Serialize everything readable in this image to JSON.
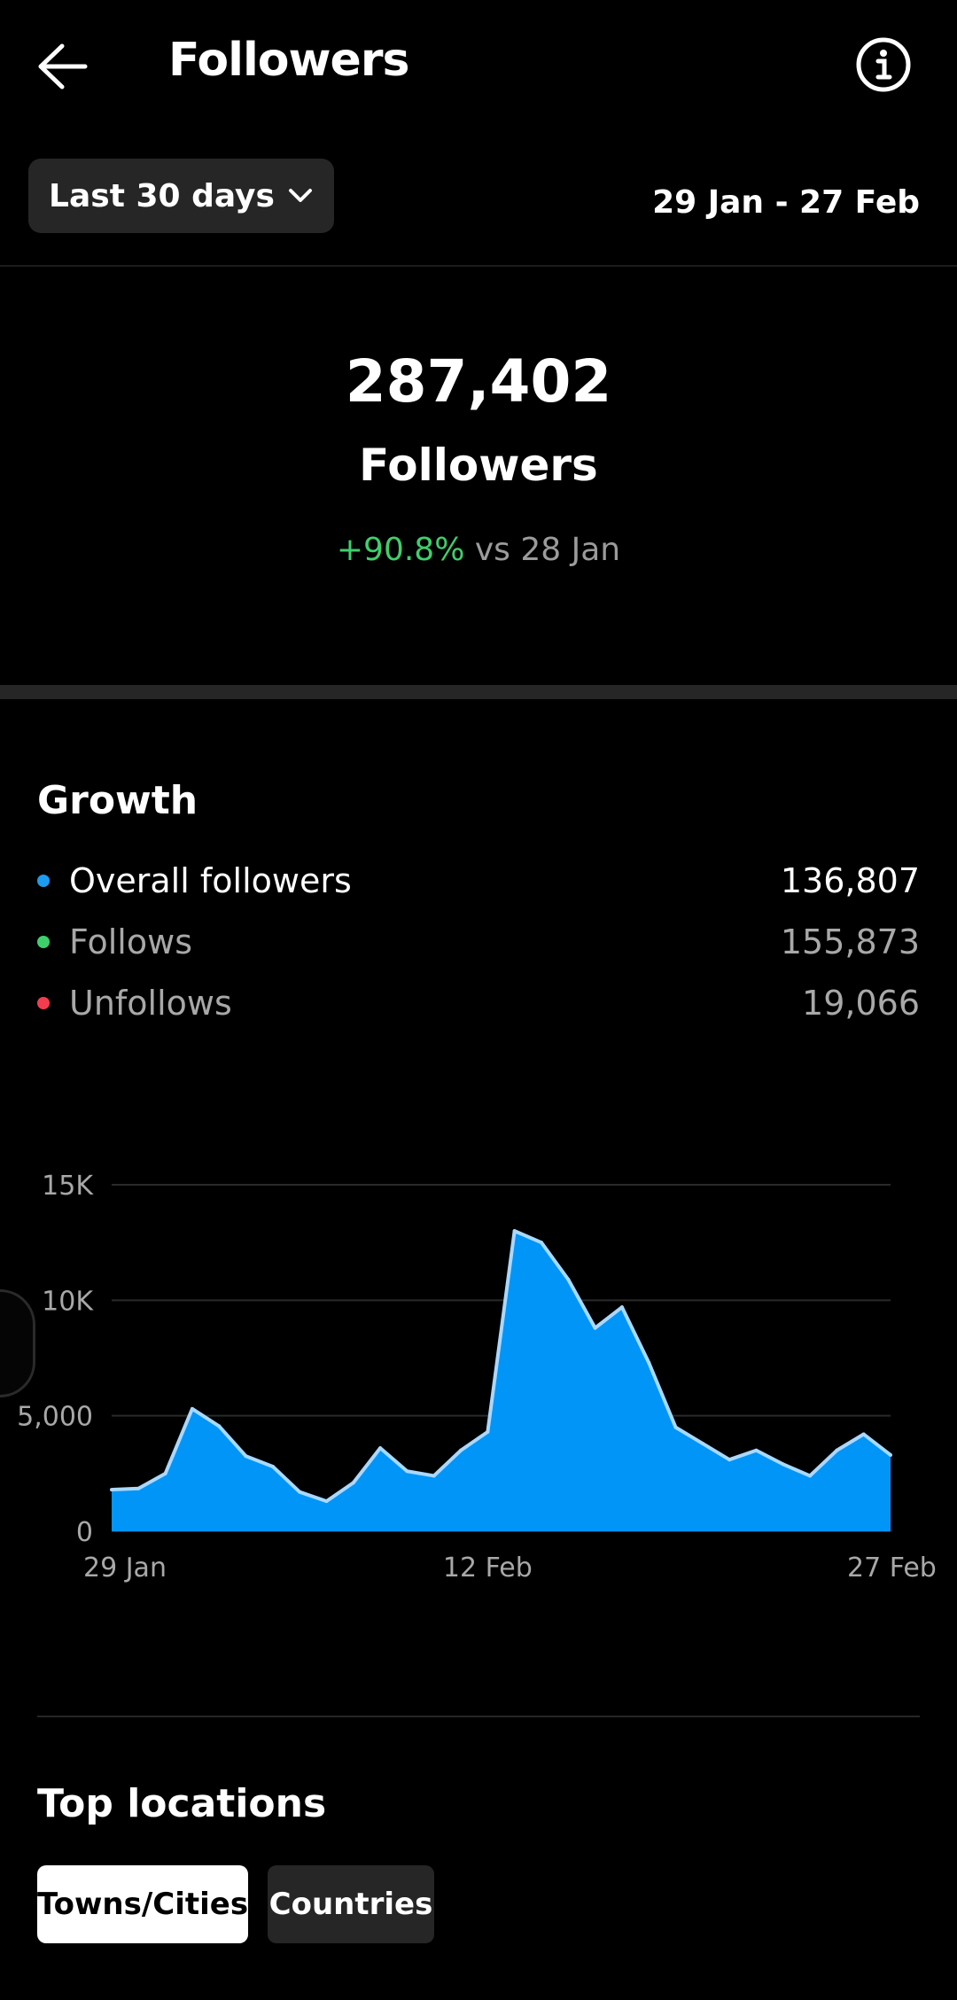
{
  "header": {
    "title": "Followers"
  },
  "filters": {
    "range_label": "Last 30 days",
    "date_range": "29 Jan - 27 Feb"
  },
  "summary": {
    "total": "287,402",
    "label": "Followers",
    "change_pct": "+90.8%",
    "change_ref": "vs 28 Jan"
  },
  "growth": {
    "title": "Growth",
    "legend": [
      {
        "name": "Overall followers",
        "value": "136,807",
        "color": "#1d9bf0"
      },
      {
        "name": "Follows",
        "value": "155,873",
        "color": "#3ecf6c"
      },
      {
        "name": "Unfollows",
        "value": "19,066",
        "color": "#f23d4f"
      }
    ]
  },
  "colors": {
    "accent": "#0095f6",
    "positive": "#3ecf6c",
    "chip_bg": "#262626"
  },
  "chart_data": {
    "type": "area",
    "x": [
      "29 Jan",
      "30 Jan",
      "31 Jan",
      "1 Feb",
      "2 Feb",
      "3 Feb",
      "4 Feb",
      "5 Feb",
      "6 Feb",
      "7 Feb",
      "8 Feb",
      "9 Feb",
      "10 Feb",
      "11 Feb",
      "12 Feb",
      "13 Feb",
      "14 Feb",
      "15 Feb",
      "16 Feb",
      "17 Feb",
      "18 Feb",
      "19 Feb",
      "20 Feb",
      "21 Feb",
      "22 Feb",
      "23 Feb",
      "24 Feb",
      "25 Feb",
      "26 Feb",
      "27 Feb"
    ],
    "series": [
      {
        "name": "Overall followers",
        "values": [
          1800,
          1850,
          2500,
          5300,
          4550,
          3250,
          2800,
          1700,
          1300,
          2100,
          3600,
          2600,
          2400,
          3500,
          4300,
          13000,
          12500,
          10900,
          8800,
          9700,
          7300,
          4500,
          3800,
          3100,
          3500,
          2900,
          2400,
          3500,
          4200,
          3300
        ]
      }
    ],
    "x_ticks": [
      "29 Jan",
      "12 Feb",
      "27 Feb"
    ],
    "y_ticks": [
      "0",
      "5,000",
      "10K",
      "15K"
    ],
    "ylim": [
      0,
      15000
    ],
    "grid": true
  },
  "locations": {
    "title": "Top locations",
    "tabs": [
      {
        "label": "Towns/Cities",
        "active": true
      },
      {
        "label": "Countries",
        "active": false
      }
    ]
  }
}
